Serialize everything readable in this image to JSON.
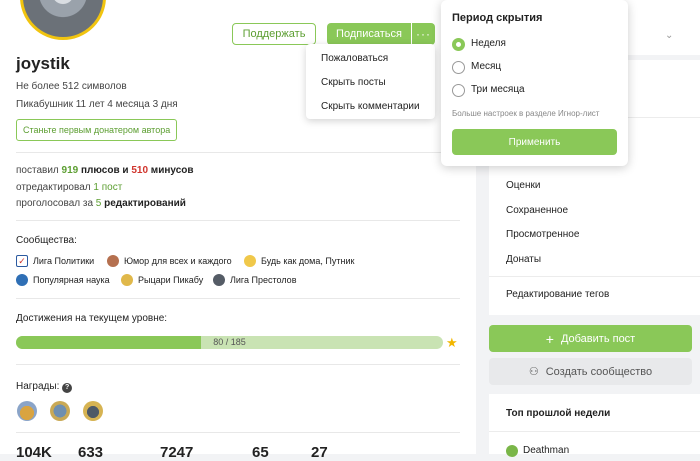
{
  "profile": {
    "username": "joystik",
    "bio": "Не более 512 символов",
    "member_since": "Пикабушник 11 лет 4 месяца 3 дня",
    "first_donor_label": "Станьте первым донатером автора"
  },
  "actions": {
    "donate_label": "Поддержать",
    "subscribe_label": "Подписаться",
    "more_label": "···"
  },
  "more_menu": {
    "items": [
      "Пожаловаться",
      "Скрыть посты",
      "Скрыть комментарии"
    ]
  },
  "stats": {
    "line1_prefix": "поставил",
    "pluses": "919",
    "pluses_word": "плюсов и",
    "minuses": "510",
    "minuses_word": "минусов",
    "line2_prefix": "отредактировал",
    "edited_posts": "1 пост",
    "line3_prefix": "проголосовал за",
    "votes": "5",
    "votes_word": "редактирований"
  },
  "communities": {
    "title": "Сообщества:",
    "items": [
      "Лига Политики",
      "Юмор для всех и каждого",
      "Будь как дома, Путник",
      "Популярная наука",
      "Рыцари Пикабу",
      "Лига Престолов"
    ]
  },
  "achievements": {
    "title": "Достижения на текущем уровне:",
    "progress_text": "80 / 185",
    "progress_value": 80,
    "progress_max": 185
  },
  "awards": {
    "title": "Награды:",
    "help": "?"
  },
  "counters": [
    "104K",
    "633",
    "7247",
    "65",
    "27"
  ],
  "hide_popup": {
    "title": "Период скрытия",
    "options": [
      "Неделя",
      "Месяц",
      "Три месяца"
    ],
    "selected": "Неделя",
    "hint": "Больше настроек в разделе Игнор-лист",
    "apply_label": "Применить"
  },
  "sidebar": {
    "links": [
      "Оценки",
      "Сохраненное",
      "Просмотренное",
      "Донаты",
      "Редактирование тегов"
    ],
    "add_post_label": "Добавить пост",
    "create_community_label": "Создать сообщество",
    "top_week_title": "Топ прошлой недели",
    "top_user": "Deathman"
  },
  "colors": {
    "accent": "#8ac858",
    "accent_text": "#5c9e31",
    "minus": "#d0342c",
    "progress_bg": "#c9e3b3",
    "star": "#f2b600"
  }
}
